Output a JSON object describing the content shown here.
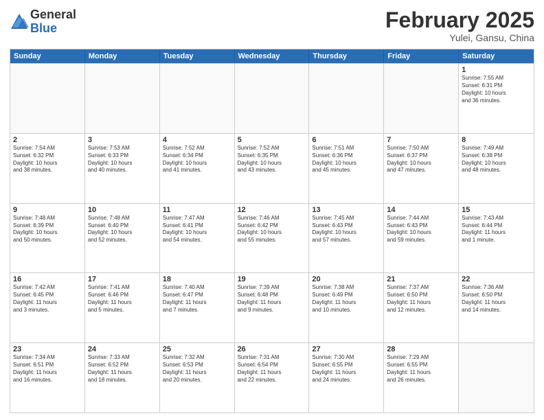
{
  "logo": {
    "general": "General",
    "blue": "Blue"
  },
  "title": "February 2025",
  "subtitle": "Yulei, Gansu, China",
  "days": [
    "Sunday",
    "Monday",
    "Tuesday",
    "Wednesday",
    "Thursday",
    "Friday",
    "Saturday"
  ],
  "weeks": [
    [
      {
        "day": "",
        "info": ""
      },
      {
        "day": "",
        "info": ""
      },
      {
        "day": "",
        "info": ""
      },
      {
        "day": "",
        "info": ""
      },
      {
        "day": "",
        "info": ""
      },
      {
        "day": "",
        "info": ""
      },
      {
        "day": "1",
        "info": "Sunrise: 7:55 AM\nSunset: 6:31 PM\nDaylight: 10 hours\nand 36 minutes."
      }
    ],
    [
      {
        "day": "2",
        "info": "Sunrise: 7:54 AM\nSunset: 6:32 PM\nDaylight: 10 hours\nand 38 minutes."
      },
      {
        "day": "3",
        "info": "Sunrise: 7:53 AM\nSunset: 6:33 PM\nDaylight: 10 hours\nand 40 minutes."
      },
      {
        "day": "4",
        "info": "Sunrise: 7:52 AM\nSunset: 6:34 PM\nDaylight: 10 hours\nand 41 minutes."
      },
      {
        "day": "5",
        "info": "Sunrise: 7:52 AM\nSunset: 6:35 PM\nDaylight: 10 hours\nand 43 minutes."
      },
      {
        "day": "6",
        "info": "Sunrise: 7:51 AM\nSunset: 6:36 PM\nDaylight: 10 hours\nand 45 minutes."
      },
      {
        "day": "7",
        "info": "Sunrise: 7:50 AM\nSunset: 6:37 PM\nDaylight: 10 hours\nand 47 minutes."
      },
      {
        "day": "8",
        "info": "Sunrise: 7:49 AM\nSunset: 6:38 PM\nDaylight: 10 hours\nand 48 minutes."
      }
    ],
    [
      {
        "day": "9",
        "info": "Sunrise: 7:48 AM\nSunset: 6:39 PM\nDaylight: 10 hours\nand 50 minutes."
      },
      {
        "day": "10",
        "info": "Sunrise: 7:48 AM\nSunset: 6:40 PM\nDaylight: 10 hours\nand 52 minutes."
      },
      {
        "day": "11",
        "info": "Sunrise: 7:47 AM\nSunset: 6:41 PM\nDaylight: 10 hours\nand 54 minutes."
      },
      {
        "day": "12",
        "info": "Sunrise: 7:46 AM\nSunset: 6:42 PM\nDaylight: 10 hours\nand 55 minutes."
      },
      {
        "day": "13",
        "info": "Sunrise: 7:45 AM\nSunset: 6:43 PM\nDaylight: 10 hours\nand 57 minutes."
      },
      {
        "day": "14",
        "info": "Sunrise: 7:44 AM\nSunset: 6:43 PM\nDaylight: 10 hours\nand 59 minutes."
      },
      {
        "day": "15",
        "info": "Sunrise: 7:43 AM\nSunset: 6:44 PM\nDaylight: 11 hours\nand 1 minute."
      }
    ],
    [
      {
        "day": "16",
        "info": "Sunrise: 7:42 AM\nSunset: 6:45 PM\nDaylight: 11 hours\nand 3 minutes."
      },
      {
        "day": "17",
        "info": "Sunrise: 7:41 AM\nSunset: 6:46 PM\nDaylight: 11 hours\nand 5 minutes."
      },
      {
        "day": "18",
        "info": "Sunrise: 7:40 AM\nSunset: 6:47 PM\nDaylight: 11 hours\nand 7 minutes."
      },
      {
        "day": "19",
        "info": "Sunrise: 7:39 AM\nSunset: 6:48 PM\nDaylight: 11 hours\nand 9 minutes."
      },
      {
        "day": "20",
        "info": "Sunrise: 7:38 AM\nSunset: 6:49 PM\nDaylight: 11 hours\nand 10 minutes."
      },
      {
        "day": "21",
        "info": "Sunrise: 7:37 AM\nSunset: 6:50 PM\nDaylight: 11 hours\nand 12 minutes."
      },
      {
        "day": "22",
        "info": "Sunrise: 7:36 AM\nSunset: 6:50 PM\nDaylight: 11 hours\nand 14 minutes."
      }
    ],
    [
      {
        "day": "23",
        "info": "Sunrise: 7:34 AM\nSunset: 6:51 PM\nDaylight: 11 hours\nand 16 minutes."
      },
      {
        "day": "24",
        "info": "Sunrise: 7:33 AM\nSunset: 6:52 PM\nDaylight: 11 hours\nand 18 minutes."
      },
      {
        "day": "25",
        "info": "Sunrise: 7:32 AM\nSunset: 6:53 PM\nDaylight: 11 hours\nand 20 minutes."
      },
      {
        "day": "26",
        "info": "Sunrise: 7:31 AM\nSunset: 6:54 PM\nDaylight: 11 hours\nand 22 minutes."
      },
      {
        "day": "27",
        "info": "Sunrise: 7:30 AM\nSunset: 6:55 PM\nDaylight: 11 hours\nand 24 minutes."
      },
      {
        "day": "28",
        "info": "Sunrise: 7:29 AM\nSunset: 6:55 PM\nDaylight: 11 hours\nand 26 minutes."
      },
      {
        "day": "",
        "info": ""
      }
    ]
  ]
}
